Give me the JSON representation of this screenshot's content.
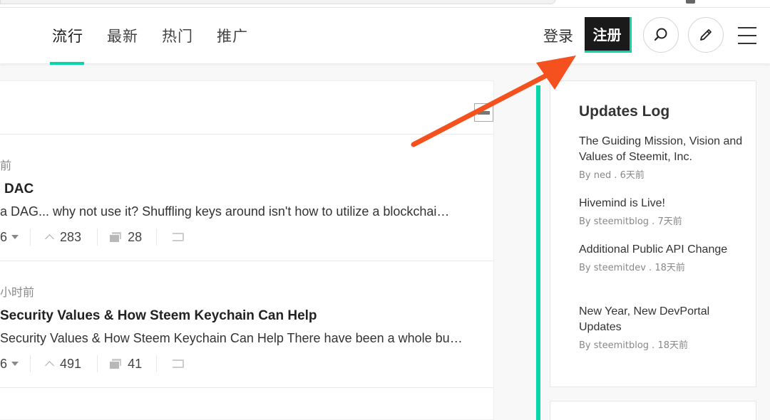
{
  "header": {
    "tabs": [
      {
        "label": "流行",
        "active": true
      },
      {
        "label": "最新",
        "active": false
      },
      {
        "label": "热门",
        "active": false
      },
      {
        "label": "推广",
        "active": false
      }
    ],
    "login_label": "登录",
    "signup_label": "注册",
    "search_icon": "search-icon",
    "compose_icon": "pencil-icon",
    "menu_icon": "hamburger-menu-icon",
    "accent_color": "#06d6a9"
  },
  "feed": {
    "posts": [
      {
        "meta": "前",
        "title": "DAC",
        "excerpt": "a DAG... why not use it? Shuffling keys around isn't how to utilize a blockchai…",
        "payout_fragment": "6",
        "votes": "283",
        "comments": "28"
      },
      {
        "meta": "小时前",
        "title": "Security Values & How Steem Keychain Can Help",
        "excerpt": "Security Values & How Steem Keychain Can Help There have been a whole bu…",
        "payout_fragment": "6",
        "votes": "491",
        "comments": "41"
      }
    ]
  },
  "sidebar": {
    "title": "Updates Log",
    "items": [
      {
        "title": "The Guiding Mission, Vision and Values of Steemit, Inc.",
        "meta": "By ned . 6天前"
      },
      {
        "title": "Hivemind is Live!",
        "meta": "By steemitblog . 7天前"
      },
      {
        "title": "Additional Public API Change",
        "meta": "By steemitdev . 18天前"
      },
      {
        "title": "New Year, New DevPortal Updates",
        "meta": "By steemitblog . 18天前"
      }
    ]
  },
  "annotation": {
    "arrow_color": "#f4511e"
  }
}
